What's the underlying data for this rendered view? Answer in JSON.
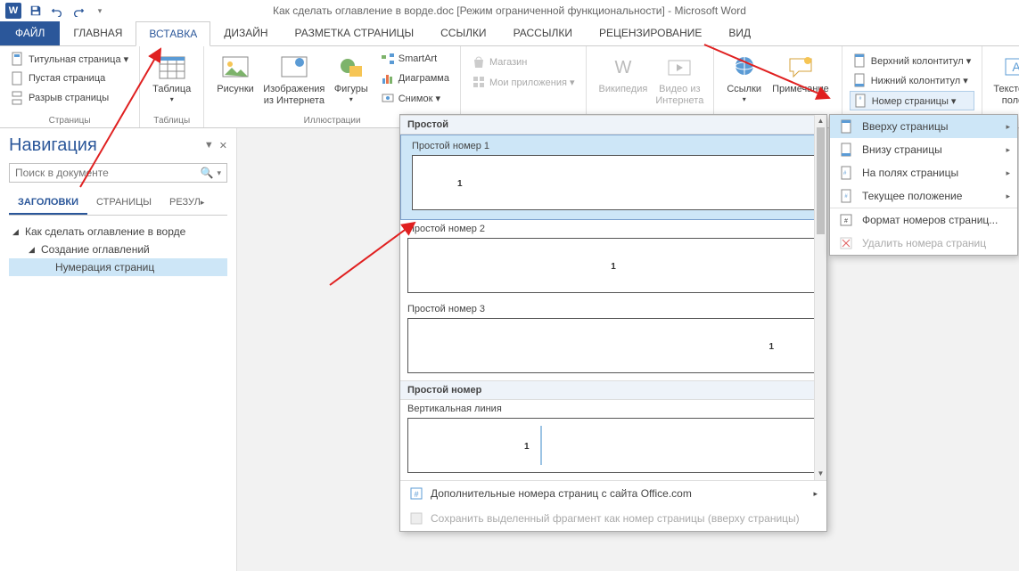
{
  "titlebar": {
    "title": "Как сделать оглавление в ворде.doc [Режим ограниченной функциональности] - Microsoft Word"
  },
  "tabs": {
    "file": "ФАЙЛ",
    "home": "ГЛАВНАЯ",
    "insert": "ВСТАВКА",
    "design": "ДИЗАЙН",
    "layout": "РАЗМЕТКА СТРАНИЦЫ",
    "references": "ССЫЛКИ",
    "mail": "РАССЫЛКИ",
    "review": "РЕЦЕНЗИРОВАНИЕ",
    "view": "ВИД"
  },
  "ribbon": {
    "pages": {
      "cover": "Титульная страница ▾",
      "blank": "Пустая страница",
      "break": "Разрыв страницы",
      "label": "Страницы"
    },
    "tables": {
      "table": "Таблица",
      "label": "Таблицы"
    },
    "illust": {
      "pictures": "Рисунки",
      "online": "Изображения из Интернета",
      "shapes": "Фигуры",
      "smart": "SmartArt",
      "chart": "Диаграмма",
      "screen": "Снимок ▾",
      "label": "Иллюстрации"
    },
    "apps": {
      "store": "Магазин",
      "my": "Мои приложения ▾"
    },
    "media": {
      "wiki": "Википедия",
      "video": "Видео из Интернета"
    },
    "links": {
      "links": "Ссылки",
      "comment": "Примечание"
    },
    "hf": {
      "header": "Верхний колонтитул ▾",
      "footer": "Нижний колонтитул ▾",
      "pagenum": "Номер страницы ▾"
    },
    "text": {
      "textbox": "Текстовое поле ▾"
    }
  },
  "nav": {
    "title": "Навигация",
    "search_ph": "Поиск в документе",
    "tabs": {
      "heads": "ЗАГОЛОВКИ",
      "pages": "СТРАНИЦЫ",
      "results": "РЕЗУЛ"
    },
    "tree": {
      "i1": "Как сделать оглавление в ворде",
      "i2": "Создание оглавлений",
      "i3": "Нумерация страниц"
    }
  },
  "gallery": {
    "sec1": "Простой",
    "i1": "Простой номер 1",
    "i2": "Простой номер 2",
    "i3": "Простой номер 3",
    "sec2": "Простой номер",
    "i4": "Вертикальная линия",
    "foot1": "Дополнительные номера страниц с сайта Office.com",
    "foot2": "Сохранить выделенный фрагмент как номер страницы (вверху страницы)"
  },
  "submenu": {
    "top": "Вверху страницы",
    "bottom": "Внизу страницы",
    "margins": "На полях страницы",
    "current": "Текущее положение",
    "format": "Формат номеров страниц...",
    "remove": "Удалить номера страниц"
  }
}
